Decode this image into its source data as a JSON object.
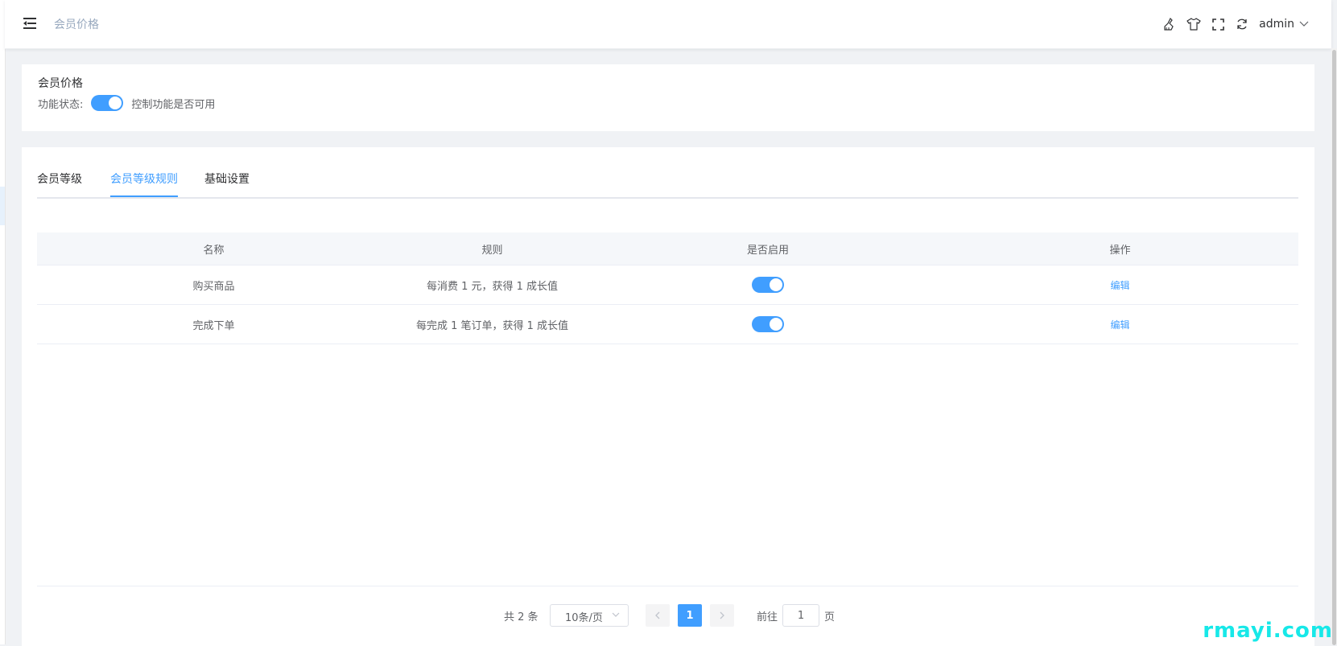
{
  "header": {
    "breadcrumb": "会员价格",
    "icons": [
      "cleaner-icon",
      "shirt-icon",
      "fullscreen-icon",
      "refresh-icon",
      "chevron-down-icon"
    ],
    "username": "admin"
  },
  "feature": {
    "title": "会员价格",
    "status_label": "功能状态:",
    "status_enabled": true,
    "status_hint": "控制功能是否可用"
  },
  "tabs": [
    {
      "label": "会员等级",
      "active": false
    },
    {
      "label": "会员等级规则",
      "active": true
    },
    {
      "label": "基础设置",
      "active": false
    }
  ],
  "table": {
    "headers": [
      "名称",
      "规则",
      "是否启用",
      "操作"
    ],
    "rows": [
      {
        "name": "购买商品",
        "rule": "每消费 1 元，获得 1 成长值",
        "enabled": true,
        "action": "编辑"
      },
      {
        "name": "完成下单",
        "rule": "每完成 1 笔订单，获得 1 成长值",
        "enabled": true,
        "action": "编辑"
      }
    ]
  },
  "pagination": {
    "total_text": "共 2 条",
    "page_size": "10条/页",
    "current_page": "1",
    "goto_label": "前往",
    "goto_value": "1",
    "page_suffix": "页"
  },
  "colors": {
    "primary": "#409eff",
    "background": "#f0f2f5",
    "watermark": "#17e8e8"
  },
  "watermark": "rmayi.com"
}
